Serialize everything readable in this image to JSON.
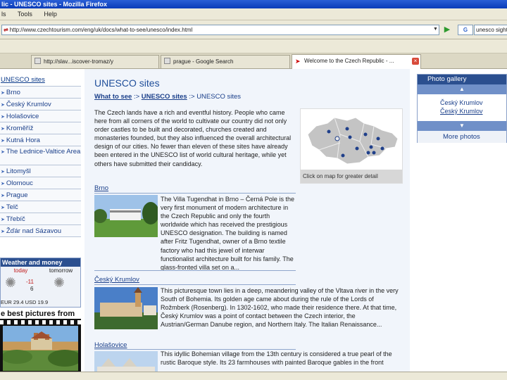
{
  "browser": {
    "title": "lic - UNESCO sites - Mozilla Firefox",
    "menu": [
      "ls",
      "Tools",
      "Help"
    ],
    "url": "http://www.czechtourism.com/eng/uk/docs/what-to-see/unesco/index.html",
    "search_engine": "G",
    "search_text": "unesco sights",
    "tabs": [
      {
        "title": "http://slav...iscover-tromaz/y"
      },
      {
        "title": "prague - Google Search"
      },
      {
        "title": "Welcome to the Czech Republic - ..."
      }
    ]
  },
  "sidebar": {
    "header": "UNESCO sites",
    "items": [
      "Brno",
      "Český Krumlov",
      "Holašovice",
      "Kroměříž",
      "Kutná Hora",
      "The Lednice-Valtice Area",
      "Litomyšl",
      "Olomouc",
      "Prague",
      "Telč",
      "Třebíč",
      "Žďár nad Sázavou"
    ]
  },
  "weather": {
    "title": "Weather and money",
    "today_label": "today",
    "tomorrow_label": "tomorrow",
    "today_high": "-11",
    "today_low": "6",
    "rates_line": "EUR 29.4        USD 19.9"
  },
  "best_pictures": {
    "title": "e best pictures from"
  },
  "main": {
    "title": "UNESCO sites",
    "breadcrumb": {
      "item1": "What to see",
      "sep1": " :> ",
      "item2": "UNESCO sites",
      "sep2": " :> ",
      "current": "UNESCO sites"
    },
    "intro": "The Czech lands have a rich and eventful history. People who came here from all corners of the world to cultivate our country did not only order castles to be built and decorated, churches created and monasteries founded, but they also influenced the overall architectural design of our cities. No fewer than eleven of these sites have already been entered in the UNESCO list of world cultural heritage, while yet others have submitted their candidacy.",
    "map_caption": "Click on map for greater detail",
    "sections": [
      {
        "title": "Brno",
        "text": "The Villa Tugendhat in Brno – Černá Pole is the very first monument of modern architecture in the Czech Republic and only the fourth worldwide which has received the prestigious UNESCO designation. The building is named after Fritz Tugendhat, owner of a Brno textile factory who had this jewel of interwar functionalist architecture built for his family. The glass-fronted villa set on a..."
      },
      {
        "title": "Český Krumlov",
        "text": "This picturesque town lies in a deep, meandering valley of the Vltava river in the very South of Bohemia. Its golden age came about during the rule of the Lords of Rožmberk (Rosenberg). In 1302-1602, who made their residence there. At that time, Český Krumlov was a point of contact between the Czech interior, the Austrian/German Danube region, and Northern Italy. The Italian Renaissance..."
      },
      {
        "title": "Holašovice",
        "text": "This idyllic Bohemian village from the 13th century is considered a true pearl of the rustic Baroque style. Its 23 farmhouses with painted Baroque gables in the front"
      }
    ]
  },
  "gallery": {
    "title": "Photo gallery",
    "caption1": "Český Krumlov",
    "caption2": "Český Krumlov",
    "more": "More photos"
  }
}
